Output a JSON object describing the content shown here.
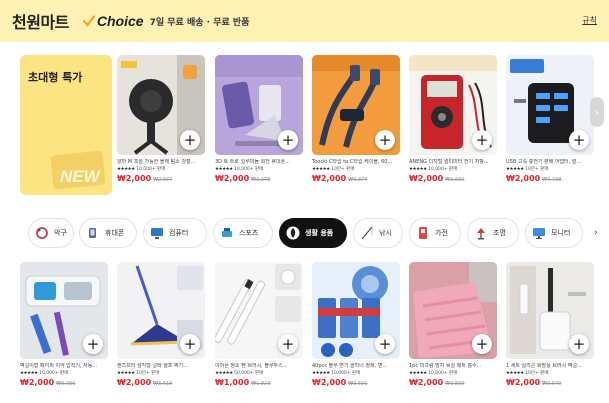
{
  "banner": {
    "brand": "천원마트",
    "choice": "Choice",
    "promo": "7일 무료 배송 · 무료 반품",
    "rules": "규칙",
    "check_color": "#f5a623"
  },
  "promo_card": {
    "title": "초대형 특가",
    "badge": "NEW"
  },
  "top_products": [
    {
      "title": "알마 M 조절 가능한 블랙 탐소 강철...",
      "rating": "10,000+ 판매",
      "price": "₩2,000",
      "old_price": "₩2,937",
      "plus": "+"
    },
    {
      "title": "3D 토 트로 일루미늄 회전 휴대폰...",
      "rating": "10,000+ 판매",
      "price": "₩2,000",
      "old_price": "₩3,279",
      "plus": "+"
    },
    {
      "title": "Toocki C타입 to C타입 케이블, 60...",
      "rating": "10만+ 판매",
      "price": "₩2,000",
      "old_price": "₩3,374",
      "plus": "+"
    },
    {
      "title": "ANENG 디지털 멀티미터 전기 저항...",
      "rating": "10,000+ 판매",
      "price": "₩2,000",
      "old_price": "₩3,669",
      "plus": "+"
    },
    {
      "title": "USB 고속 충전기 분배 어댑터, 멀...",
      "rating": "10만+ 판매",
      "price": "₩2,000",
      "old_price": "₩3,738",
      "plus": "+"
    }
  ],
  "next_arrow": "›",
  "categories": [
    {
      "label": "악구",
      "icon": "bracelet-icon",
      "active": false
    },
    {
      "label": "휴대폰",
      "icon": "phone-holder-icon",
      "active": false
    },
    {
      "label": "컴퓨터",
      "icon": "computer-icon",
      "active": false
    },
    {
      "label": "스포츠",
      "icon": "sports-icon",
      "active": false
    },
    {
      "label": "생활 용품",
      "icon": "home-goods-icon",
      "active": true
    },
    {
      "label": "낚시",
      "icon": "fishing-rod-icon",
      "active": false
    },
    {
      "label": "가전",
      "icon": "appliance-icon",
      "active": false
    },
    {
      "label": "조명",
      "icon": "lamp-icon",
      "active": false
    },
    {
      "label": "모니터",
      "icon": "monitor-icon",
      "active": false
    }
  ],
  "category_arrow": "›",
  "bottom_products": [
    {
      "title": "벽걸이형 페이퍼 치약 압착기, 자동...",
      "rating": "10,000+ 판매",
      "price": "₩2,000",
      "old_price": "₩3,086",
      "plus": "+"
    },
    {
      "title": "핸즈프리 삼각형 걸레 셀프 짜기...",
      "rating": "10만+ 판매",
      "price": "₩2,000",
      "old_price": "₩3,615",
      "plus": "+"
    },
    {
      "title": "이어폰 청소 펜 브러시, 블루투스...",
      "rating": "50,000+ 판매",
      "price": "₩1,000",
      "old_price": "₩1,823",
      "plus": "+"
    },
    {
      "title": "40pcs 블루 변기 클리너 정제, 변...",
      "rating": "10,000+ 판매",
      "price": "₩2,000",
      "old_price": "₩3,501",
      "plus": "+"
    },
    {
      "title": "1pc 미끄럼 방지 욕실 매트 흡수...",
      "rating": "10,000+ 판매",
      "price": "₩2,000",
      "old_price": "₩3,839",
      "plus": "+"
    },
    {
      "title": "1 세트 실리콘 화장실 브러시 벽걸...",
      "rating": "10만+ 판매",
      "price": "₩2,000",
      "old_price": "₩3,570",
      "plus": "+"
    }
  ],
  "stars": "★★★★★",
  "colors": {
    "banner_bg": "#fdf2b4",
    "promo_bg": "#fde482",
    "price": "#e8222e",
    "active_cat": "#111111"
  }
}
